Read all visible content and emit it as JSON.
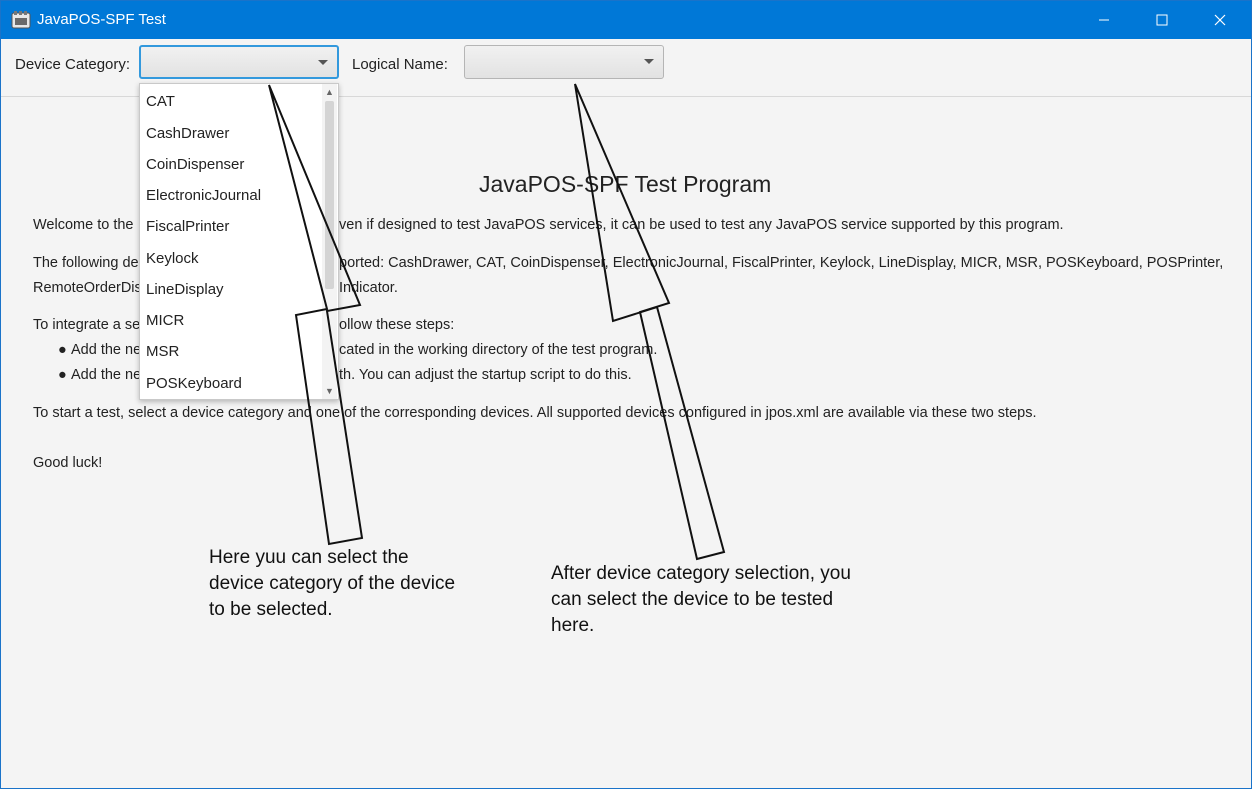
{
  "window": {
    "title": "JavaPOS-SPF Test",
    "accent_color": "#0078d7",
    "controls": [
      "minimize-icon",
      "maximize-icon",
      "close-icon"
    ]
  },
  "toolbar": {
    "category_label": "Device Category:",
    "category_value": "",
    "logical_label": "Logical Name:",
    "logical_value": ""
  },
  "dropdown": {
    "items": [
      "CAT",
      "CashDrawer",
      "CoinDispenser",
      "ElectronicJournal",
      "FiscalPrinter",
      "Keylock",
      "LineDisplay",
      "MICR",
      "MSR",
      "POSKeyboard"
    ]
  },
  "content": {
    "heading": "JavaPOS-SPF Test Program",
    "welcome": "Welcome to the",
    "welcome_rest": "ven if designed to test JavaPOS services, it can be used to test any JavaPOS service supported by this program.",
    "supported_prefix": "The following de",
    "supported_rest": "ported: CashDrawer, CAT, CoinDispenser, ElectronicJournal, FiscalPrinter, Keylock, LineDisplay, MICR, MSR, POSKeyboard, POSPrinter,",
    "supported_line2_prefix": "RemoteOrderDis",
    "supported_line2_rest": "Indicator.",
    "integrate_prefix": "To integrate a se",
    "integrate_rest": "ollow these steps:",
    "bullet1_prefix": "Add the ne",
    "bullet1_rest": "cated in the working directory of the test program.",
    "bullet2_prefix": "Add the ne",
    "bullet2_rest": "th. You can adjust the startup script to do this.",
    "start_line": "To start a test, select a device category and one of the corresponding devices. All supported devices configured in jpos.xml  are available via these two steps.",
    "good_luck": "Good luck!"
  },
  "annotations": {
    "left_note": [
      "Here yuu can select the",
      "device category of the device",
      "to be selected."
    ],
    "right_note": [
      "After device category selection, you",
      "can select the device to be tested",
      "here."
    ]
  }
}
